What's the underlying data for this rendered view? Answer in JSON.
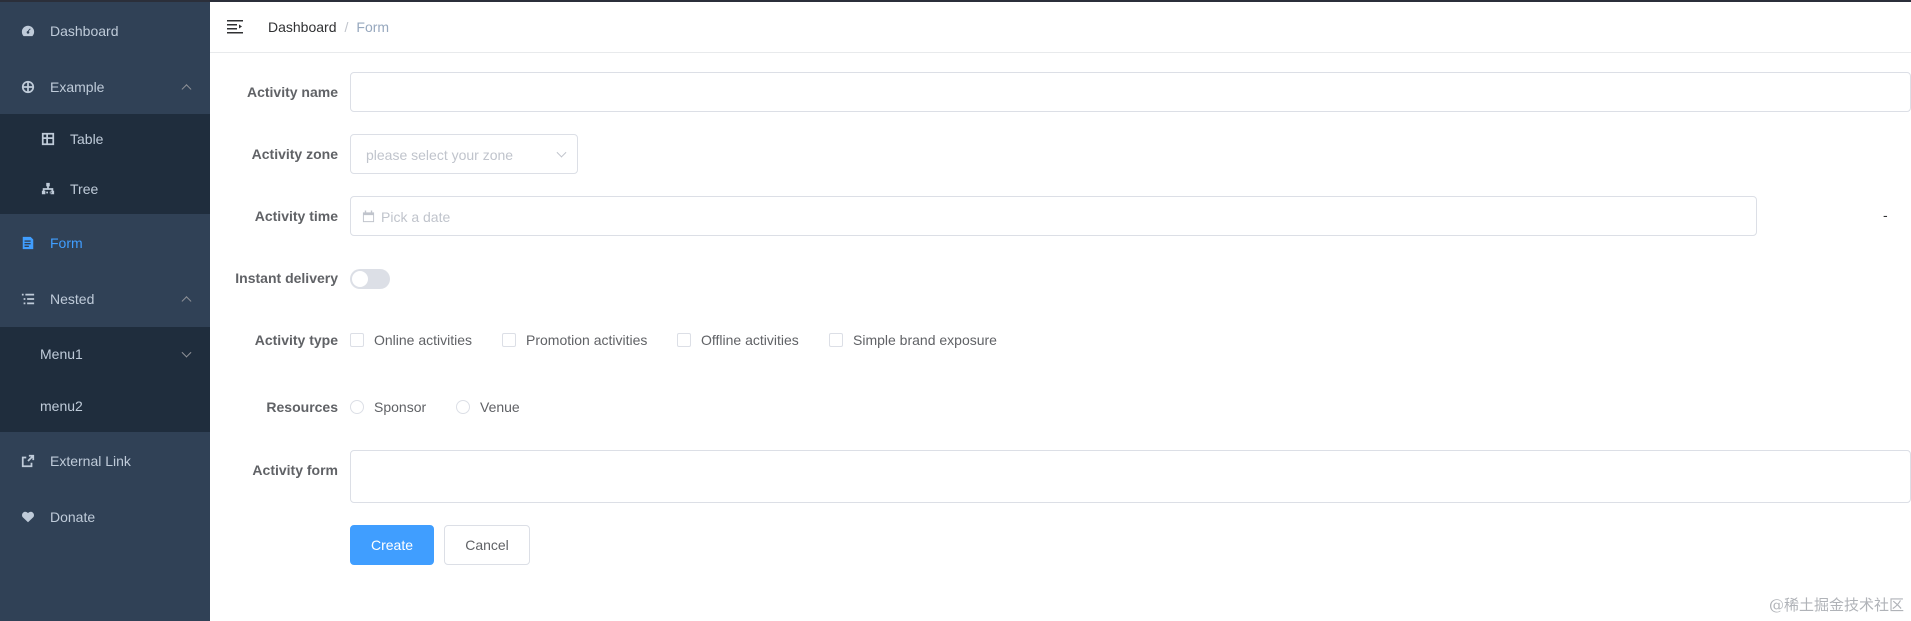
{
  "sidebar": {
    "items": [
      {
        "label": "Dashboard",
        "icon": "dashboard-icon"
      },
      {
        "label": "Example",
        "icon": "example-icon"
      },
      {
        "label": "Table",
        "icon": "table-icon"
      },
      {
        "label": "Tree",
        "icon": "tree-icon"
      },
      {
        "label": "Form",
        "icon": "form-icon",
        "active": true
      },
      {
        "label": "Nested",
        "icon": "nested-icon"
      },
      {
        "label": "Menu1"
      },
      {
        "label": "menu2"
      },
      {
        "label": "External Link",
        "icon": "external-link-icon"
      },
      {
        "label": "Donate",
        "icon": "donate-icon"
      }
    ],
    "colors": {
      "bg": "#304156",
      "submenu_bg": "#1f2d3d",
      "text": "#bfcbd9",
      "active": "#409eff"
    }
  },
  "header": {
    "breadcrumb": [
      "Dashboard",
      "Form"
    ],
    "separator": "/"
  },
  "form": {
    "name": {
      "label": "Activity name",
      "value": ""
    },
    "zone": {
      "label": "Activity zone",
      "placeholder": "please select your zone"
    },
    "time": {
      "label": "Activity time",
      "placeholder": "Pick a date",
      "separator": "-"
    },
    "delivery": {
      "label": "Instant delivery",
      "checked": false
    },
    "type": {
      "label": "Activity type",
      "options": [
        "Online activities",
        "Promotion activities",
        "Offline activities",
        "Simple brand exposure"
      ]
    },
    "resources": {
      "label": "Resources",
      "options": [
        "Sponsor",
        "Venue"
      ]
    },
    "desc": {
      "label": "Activity form",
      "value": ""
    },
    "buttons": {
      "create": "Create",
      "cancel": "Cancel"
    }
  },
  "watermark": "@稀土掘金技术社区"
}
